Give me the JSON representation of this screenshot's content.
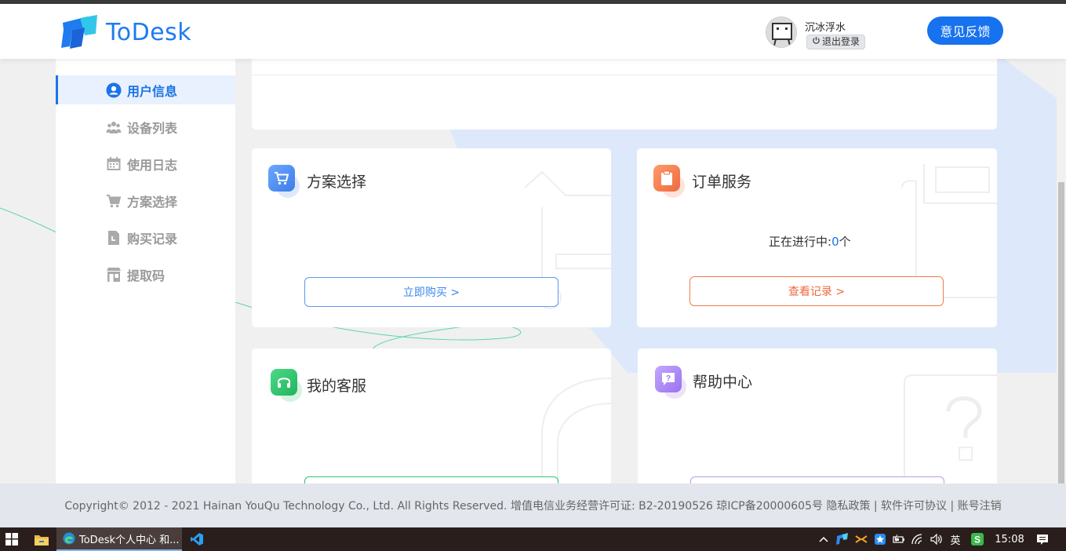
{
  "header": {
    "logo_text": "ToDesk",
    "username": "沉冰浮水",
    "logout_label": "退出登录",
    "feedback_label": "意见反馈"
  },
  "sidebar": {
    "items": [
      {
        "label": "用户信息",
        "icon": "user-circle-icon",
        "active": true
      },
      {
        "label": "设备列表",
        "icon": "users-icon",
        "active": false
      },
      {
        "label": "使用日志",
        "icon": "calendar-icon",
        "active": false
      },
      {
        "label": "方案选择",
        "icon": "cart-icon",
        "active": false
      },
      {
        "label": "购买记录",
        "icon": "document-icon",
        "active": false
      },
      {
        "label": "提取码",
        "icon": "store-icon",
        "active": false
      }
    ]
  },
  "cards": {
    "plan": {
      "title": "方案选择",
      "button": "立即购买 >",
      "icon": "cart-icon",
      "color": "#4a8ff0"
    },
    "order": {
      "title": "订单服务",
      "status_prefix": "正在进行中:",
      "count": "0",
      "unit": "个",
      "button": "查看记录 >",
      "icon": "clipboard-icon",
      "color": "#f07d4f"
    },
    "service": {
      "title": "我的客服",
      "icon": "headset-icon",
      "color": "#2ec66b"
    },
    "help": {
      "title": "帮助中心",
      "icon": "question-chat-icon",
      "color": "#a985f0"
    }
  },
  "footer": {
    "text": "Copyright© 2012 - 2021 Hainan YouQu Technology Co., Ltd. All Rights Reserved. 增值电信业务经营许可证: B2-20190526 琼ICP备20000605号 隐私政策 | 软件许可协议 | 账号注销"
  },
  "taskbar": {
    "task_title": "ToDesk个人中心 和...",
    "language": "英",
    "time": "15:08"
  },
  "colors": {
    "brand_blue": "#1672ee",
    "order_orange": "#f07d4f",
    "service_green": "#2ec66b",
    "help_purple": "#a985f0"
  }
}
